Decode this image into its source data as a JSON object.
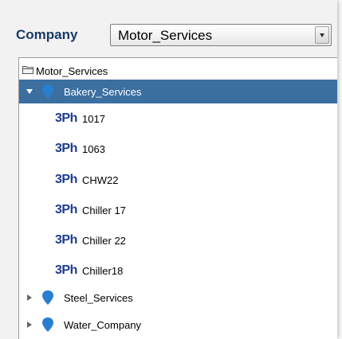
{
  "company": {
    "label": "Company",
    "selected": "Motor_Services"
  },
  "tree": {
    "root": "Motor_Services",
    "groups": [
      {
        "label": "Bakery_Services",
        "expanded": true,
        "selected": true,
        "devices": [
          {
            "badge": "3Ph",
            "label": "1017"
          },
          {
            "badge": "3Ph",
            "label": "1063"
          },
          {
            "badge": "3Ph",
            "label": "CHW22"
          },
          {
            "badge": "3Ph",
            "label": "Chiller 17"
          },
          {
            "badge": "3Ph",
            "label": "Chiller 22"
          },
          {
            "badge": "3Ph",
            "label": "Chiller18"
          }
        ]
      },
      {
        "label": "Steel_Services",
        "expanded": false
      },
      {
        "label": "Water_Company",
        "expanded": false
      }
    ]
  },
  "colors": {
    "selection": "#3b6fa0",
    "pin": "#2a7ed0",
    "badge": "#1c3c8c",
    "label": "#1a3a66"
  },
  "icons": {
    "root": "folder-icon",
    "group": "map-pin-icon",
    "device": "three-phase-icon"
  }
}
